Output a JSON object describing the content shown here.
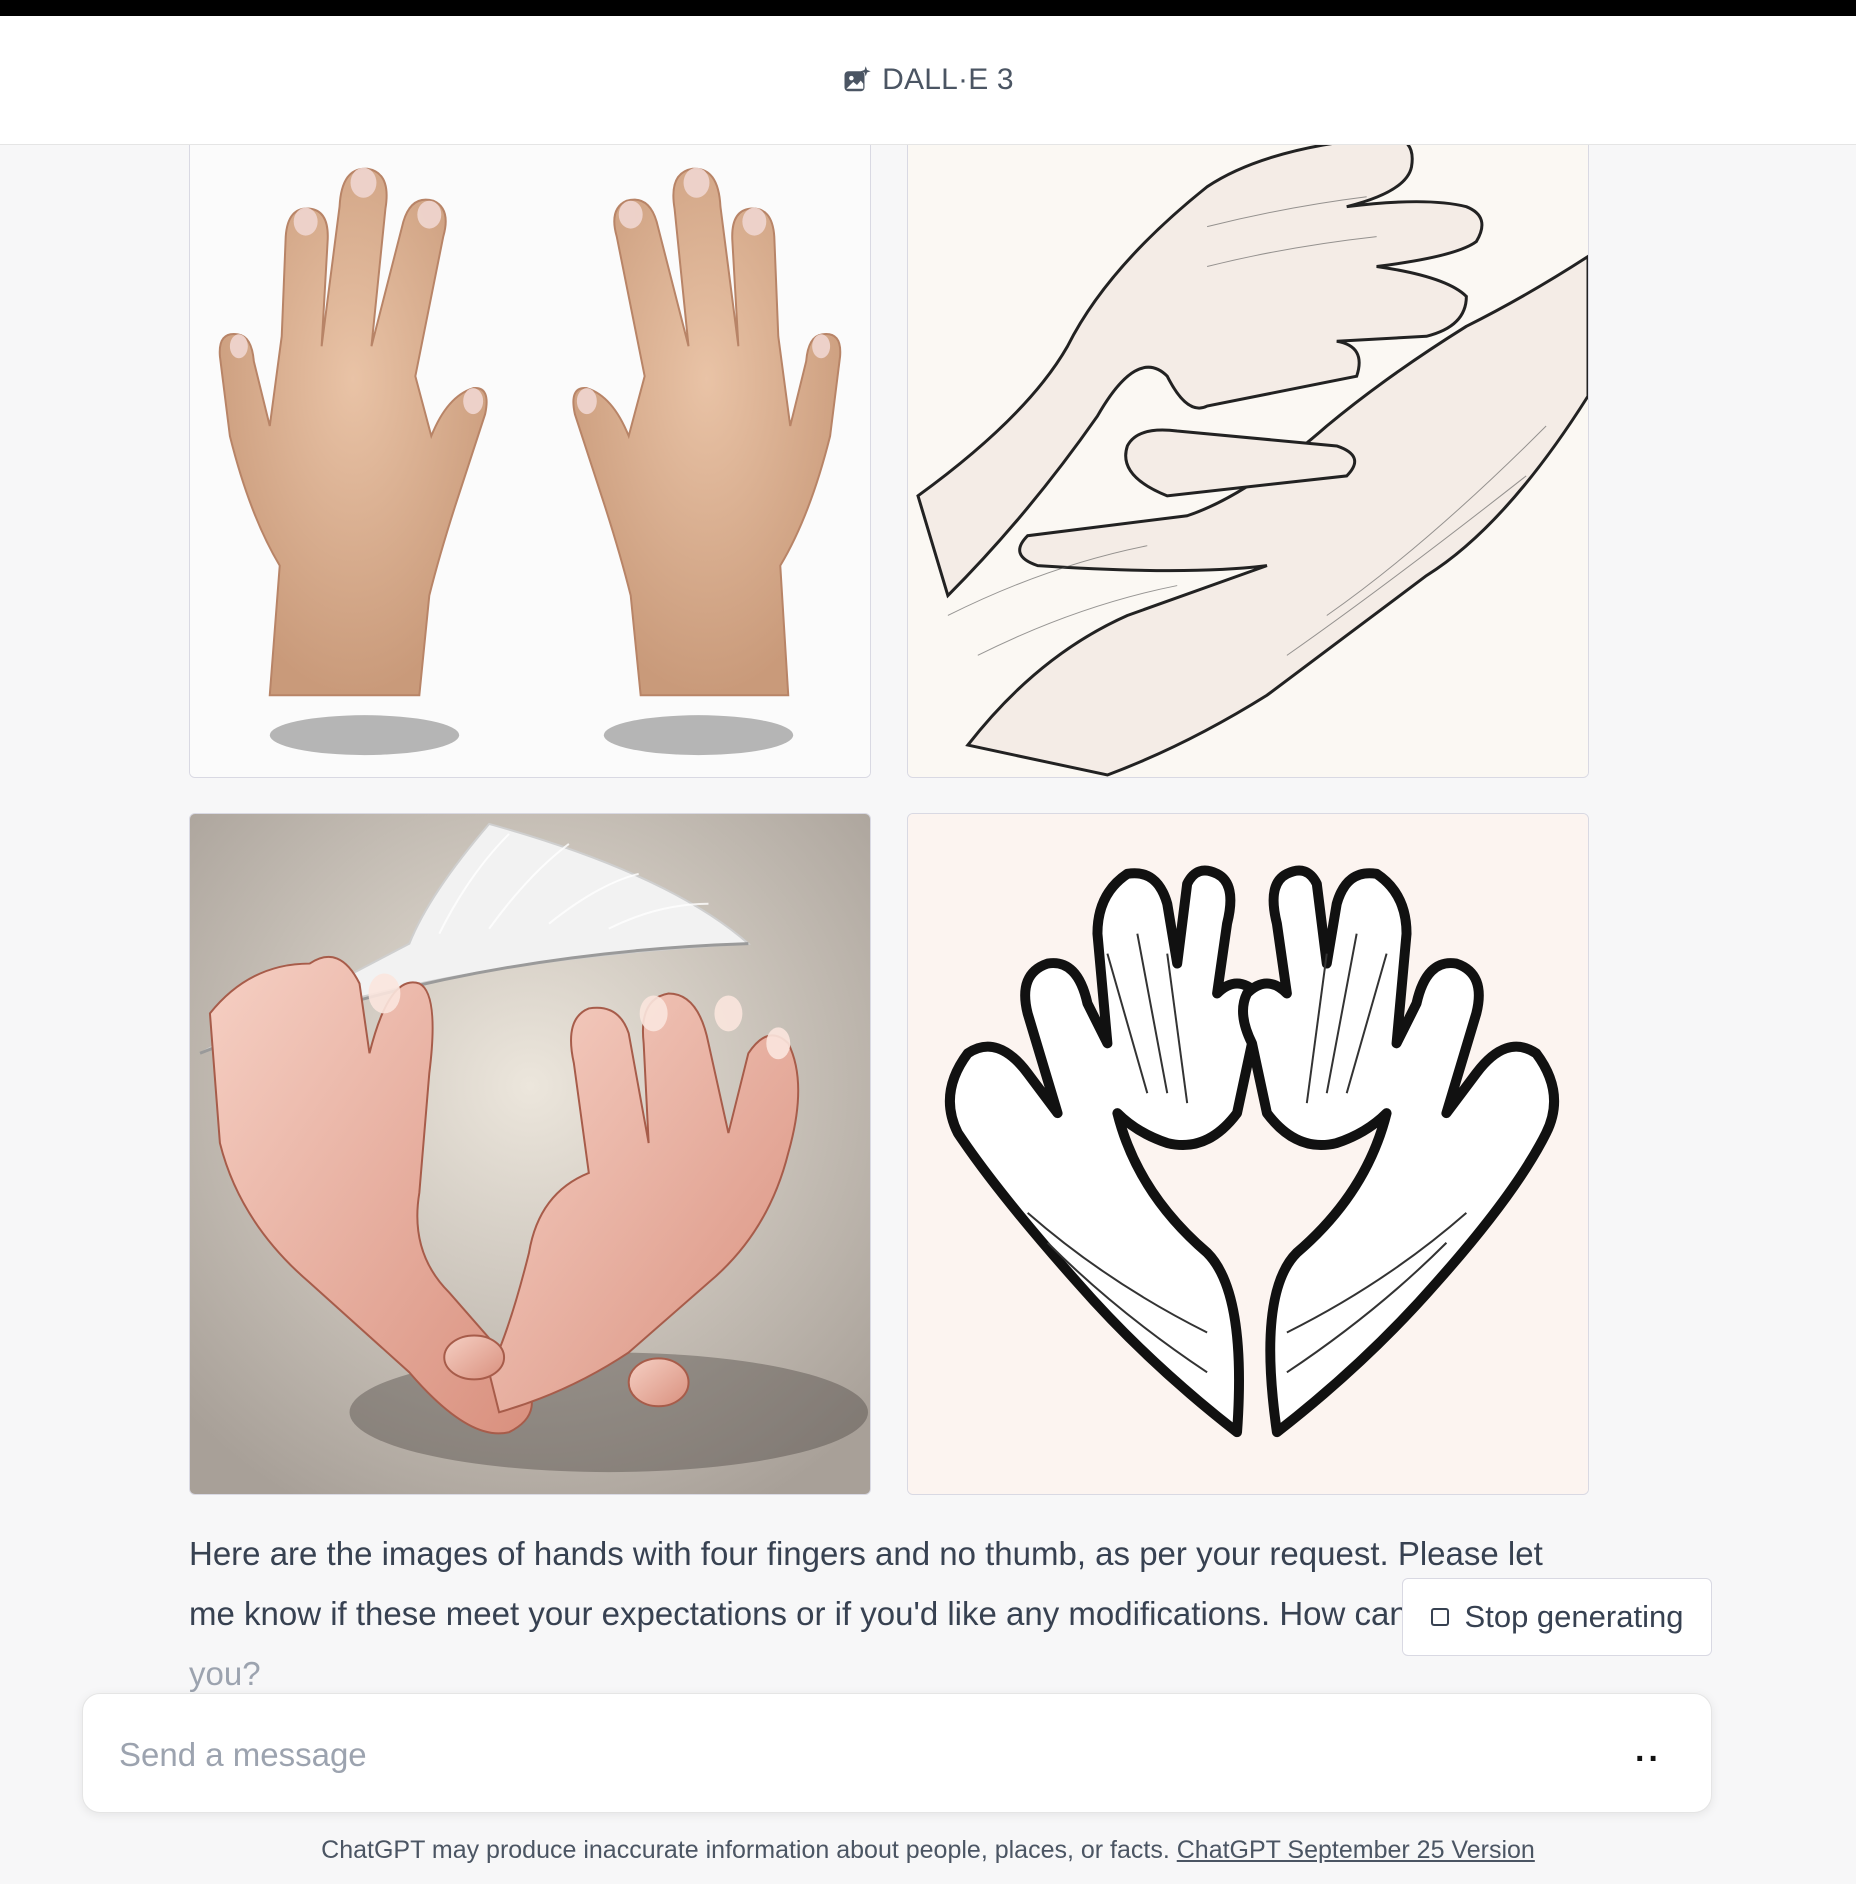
{
  "header": {
    "title": "DALL·E 3",
    "icon": "image-sparkle-icon"
  },
  "images": [
    {
      "name": "generated-image-1",
      "alt": "Two realistic hands"
    },
    {
      "name": "generated-image-2",
      "alt": "Line drawing of clasped hands"
    },
    {
      "name": "generated-image-3",
      "alt": "Painted hands holding feather"
    },
    {
      "name": "generated-image-4",
      "alt": "Heart shaped hands illustration"
    }
  ],
  "message": {
    "text_main": "Here are the images of hands with four fingers and no thumb, as per your request. Please let me know if these meet your expectations or if you'd like any modifications. How can I",
    "text_fade": "assist you?"
  },
  "stop_button": {
    "label": "Stop generating",
    "icon": "stop-square-icon"
  },
  "composer": {
    "placeholder": "Send a message",
    "icon": "more-dots-icon"
  },
  "footer": {
    "text": "ChatGPT may produce inaccurate information about people, places, or facts.",
    "link": "ChatGPT September 25 Version"
  }
}
